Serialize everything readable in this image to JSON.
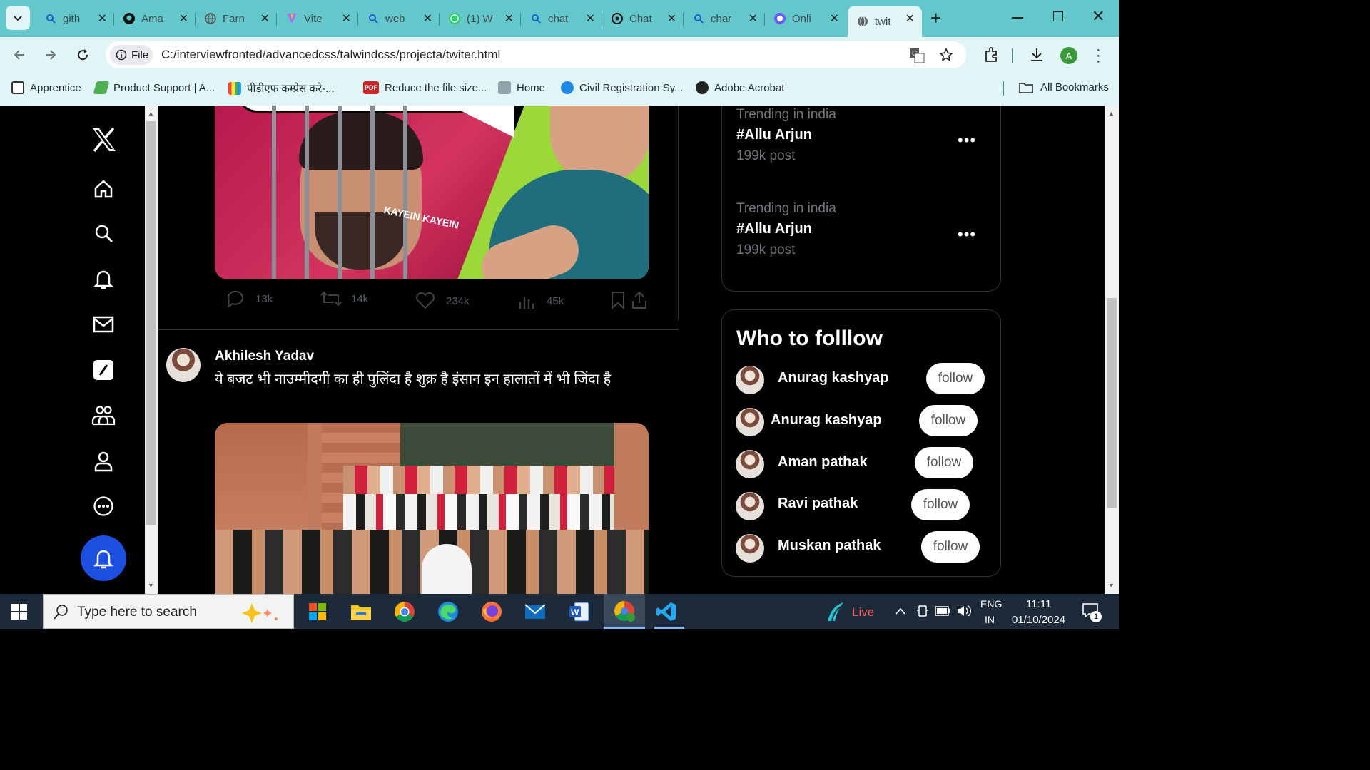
{
  "browser": {
    "tabs": [
      {
        "title": "gith",
        "icon": "search-icon"
      },
      {
        "title": "Ama",
        "icon": "github-icon"
      },
      {
        "title": "Farn",
        "icon": "globe-icon"
      },
      {
        "title": "Vite",
        "icon": "vite-icon"
      },
      {
        "title": "web",
        "icon": "search-icon"
      },
      {
        "title": "(1) W",
        "icon": "whatsapp-icon"
      },
      {
        "title": "chat",
        "icon": "search-icon"
      },
      {
        "title": "Chat",
        "icon": "openai-icon"
      },
      {
        "title": "char",
        "icon": "search-icon"
      },
      {
        "title": "Onli",
        "icon": "online-icon"
      },
      {
        "title": "twit",
        "icon": "globe-icon",
        "active": true
      }
    ],
    "address": {
      "chip": "File",
      "url": "C:/interviewfronted/advancedcss/talwindcss/projecta/twiter.html"
    },
    "profile_initial": "A",
    "bookmarks": [
      {
        "label": "Apprentice",
        "color": "#ffffff"
      },
      {
        "label": "Product Support | A...",
        "color": "#4caf50"
      },
      {
        "label": "पीडीएफ कम्प्रेस करे-...",
        "color": "#e91e63"
      },
      {
        "label": "Reduce the file size...",
        "color": "#c62828"
      },
      {
        "label": "Home",
        "color": "#90a4ae"
      },
      {
        "label": "Civil Registration Sy...",
        "color": "#1e88e5"
      },
      {
        "label": "Adobe Acrobat",
        "color": "#222222"
      }
    ],
    "all_bookmarks": "All Bookmarks"
  },
  "sidebar": {
    "logo": "X",
    "items": [
      "home-icon",
      "search-icon",
      "bell-icon",
      "mail-icon",
      "grok-icon",
      "communities-icon",
      "profile-icon",
      "more-icon"
    ],
    "fab": "bell-icon"
  },
  "feed": {
    "post1": {
      "image_caption": "KAYEIN KAYEIN",
      "stats": {
        "replies": "13k",
        "reposts": "14k",
        "likes": "234k",
        "views": "45k"
      }
    },
    "post2": {
      "author": "Akhilesh Yadav",
      "text": "ये बजट भी नाउम्मीदगी का ही पुलिंदा है शुक्र है इंसान इन हालातों में भी जिंदा है"
    }
  },
  "trending": [
    {
      "context": "Trending in india",
      "tag": "#Allu Arjun",
      "count": "199k post"
    },
    {
      "context": "Trending in india",
      "tag": "#Allu Arjun",
      "count": "199k post"
    }
  ],
  "who_to_follow": {
    "title": "Who to folllow",
    "users": [
      {
        "name": "Anurag kashyap",
        "button": "follow"
      },
      {
        "name": "Anurag kashyap",
        "button": "follow"
      },
      {
        "name": "Aman pathak",
        "button": "follow"
      },
      {
        "name": "Ravi pathak",
        "button": "follow"
      },
      {
        "name": "Muskan pathak",
        "button": "follow"
      }
    ]
  },
  "taskbar": {
    "search_placeholder": "Type here to search",
    "weather": "Live",
    "lang": "ENG",
    "region": "IN",
    "time": "11:11",
    "date": "01/10/2024",
    "notifications": "1"
  },
  "colors": {
    "accent": "#1d4fe0",
    "tabbar": "#64c7cc",
    "toolbar": "#e1f5f6"
  }
}
